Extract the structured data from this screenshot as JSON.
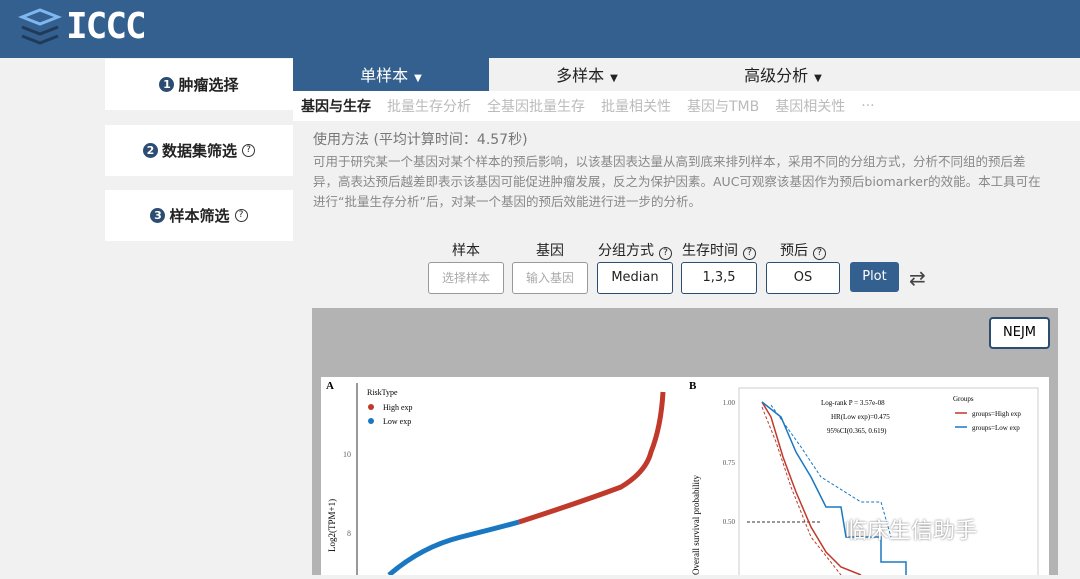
{
  "brand": "ICCC",
  "sidebar": [
    {
      "num": "1",
      "label": "肿瘤选择",
      "help": false
    },
    {
      "num": "2",
      "label": "数据集筛选",
      "help": true
    },
    {
      "num": "3",
      "label": "样本筛选",
      "help": true
    }
  ],
  "tabs": [
    {
      "label": "单样本"
    },
    {
      "label": "多样本"
    },
    {
      "label": "高级分析"
    }
  ],
  "subtabs": [
    "基因与生存",
    "批量生存分析",
    "全基因批量生存",
    "批量相关性",
    "基因与TMB",
    "基因相关性",
    "···"
  ],
  "usage": {
    "title": "使用方法 (平均计算时间：4.57秒)",
    "text": "可用于研究某一个基因对某个样本的预后影响，以该基因表达量从高到底来排列样本，采用不同的分组方式，分析不同组的预后差异，高表达预后越差即表示该基因可能促进肿瘤发展，反之为保护因素。AUC可观察该基因作为预后biomarker的效能。本工具可在进行“批量生存分析”后，对某一个基因的预后效能进行进一步的分析。"
  },
  "form": {
    "sample_label": "样本",
    "sample_placeholder": "选择样本",
    "gene_label": "基因",
    "gene_placeholder": "输入基因",
    "group_label": "分组方式",
    "group_value": "Median",
    "time_label": "生存时间",
    "time_value": "1,3,5",
    "prog_label": "预后",
    "prog_value": "OS",
    "plot": "Plot",
    "help": "?"
  },
  "nejm": "NEJM",
  "figure": {
    "a_label": "A",
    "b_label": "B",
    "risk_title": "RiskType",
    "high": "High exp",
    "low": "Low exp",
    "ylab_a": "Log2(TPM+1)",
    "yt10": "10",
    "yt8": "8",
    "ylab_b": "Overall survival probability",
    "y100": "1.00",
    "y075": "0.75",
    "y050": "0.50",
    "logrank": "Log-rank P = 3.57e-08",
    "hr": "HR(Low exp)=0.475",
    "ci": "95%CI(0.365, 0.619)",
    "groups": "Groups",
    "g_high": "groups=High exp",
    "g_low": "groups=Low exp",
    "color_high": "#c0392b",
    "color_low": "#1a78c2"
  },
  "watermark": "临床生信助手"
}
